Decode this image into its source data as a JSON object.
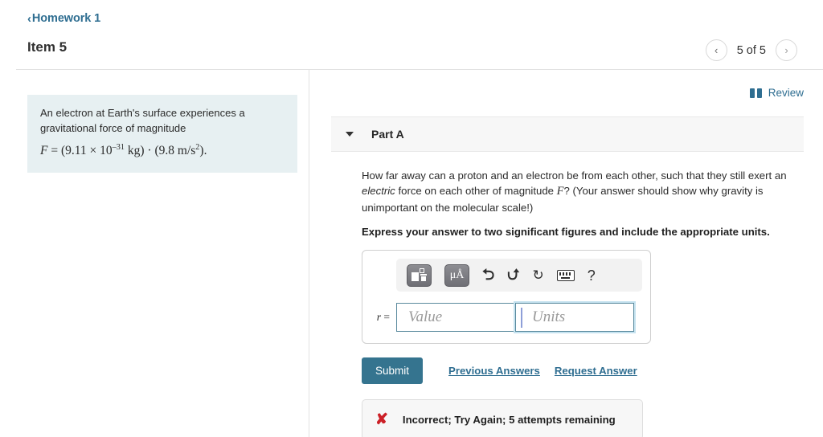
{
  "header": {
    "back_label": "Homework 1",
    "back_chevron": "‹",
    "item_title": "Item 5",
    "pager": {
      "prev_icon": "‹",
      "next_icon": "›",
      "count": "5 of 5"
    }
  },
  "left": {
    "problem_line1": "An electron at Earth's surface experiences a",
    "problem_line2": "gravitational force of magnitude",
    "formula": {
      "lhs": "F",
      "eq": " = ",
      "open1": "(9.11 × 10",
      "exp": "–31",
      "unit1": " kg",
      "close1": ")",
      "dot": " · ",
      "open2": "(9.8 ",
      "unit2": "m/s",
      "exp2": "2",
      "close2": ").",
      "plain": "F = (9.11 × 10⁻³¹ kg) · (9.8 m/s²)."
    }
  },
  "right": {
    "review_label": "Review",
    "review_icon": "book-icon",
    "part": {
      "label": "Part A",
      "caret_icon": "chevron-down-icon",
      "question_part1": "How far away can a proton and an electron be from each other, such that they still exert an ",
      "question_emphasis": "electric",
      "question_part2": " force on each other of magnitude ",
      "question_var": "F",
      "question_part3": "? (Your answer should show why gravity is unimportant on the molecular scale!)",
      "instruction": "Express your answer to two significant figures and include the appropriate units."
    },
    "answer": {
      "toolbar": {
        "template_button": "template-icon",
        "units_button": "μÅ",
        "undo_icon": "⮌",
        "redo_icon": "⮍",
        "reset_icon": "↻",
        "keyboard_icon": "keyboard-icon",
        "help_icon": "?"
      },
      "eq_prefix": "r",
      "eq_sign": " =",
      "value_placeholder": "Value",
      "units_placeholder": "Units",
      "value_text": "",
      "units_text": ""
    },
    "actions": {
      "submit_label": "Submit",
      "previous_answers_label": "Previous Answers",
      "request_answer_label": "Request Answer"
    },
    "feedback": {
      "icon": "✘",
      "text": "Incorrect; Try Again; 5 attempts remaining"
    }
  },
  "colors": {
    "link_blue": "#2f6e91",
    "submit_blue": "#35748f",
    "problem_bg": "#e7f0f2",
    "error_red": "#cc2027",
    "field_border": "#5a8a9e"
  }
}
